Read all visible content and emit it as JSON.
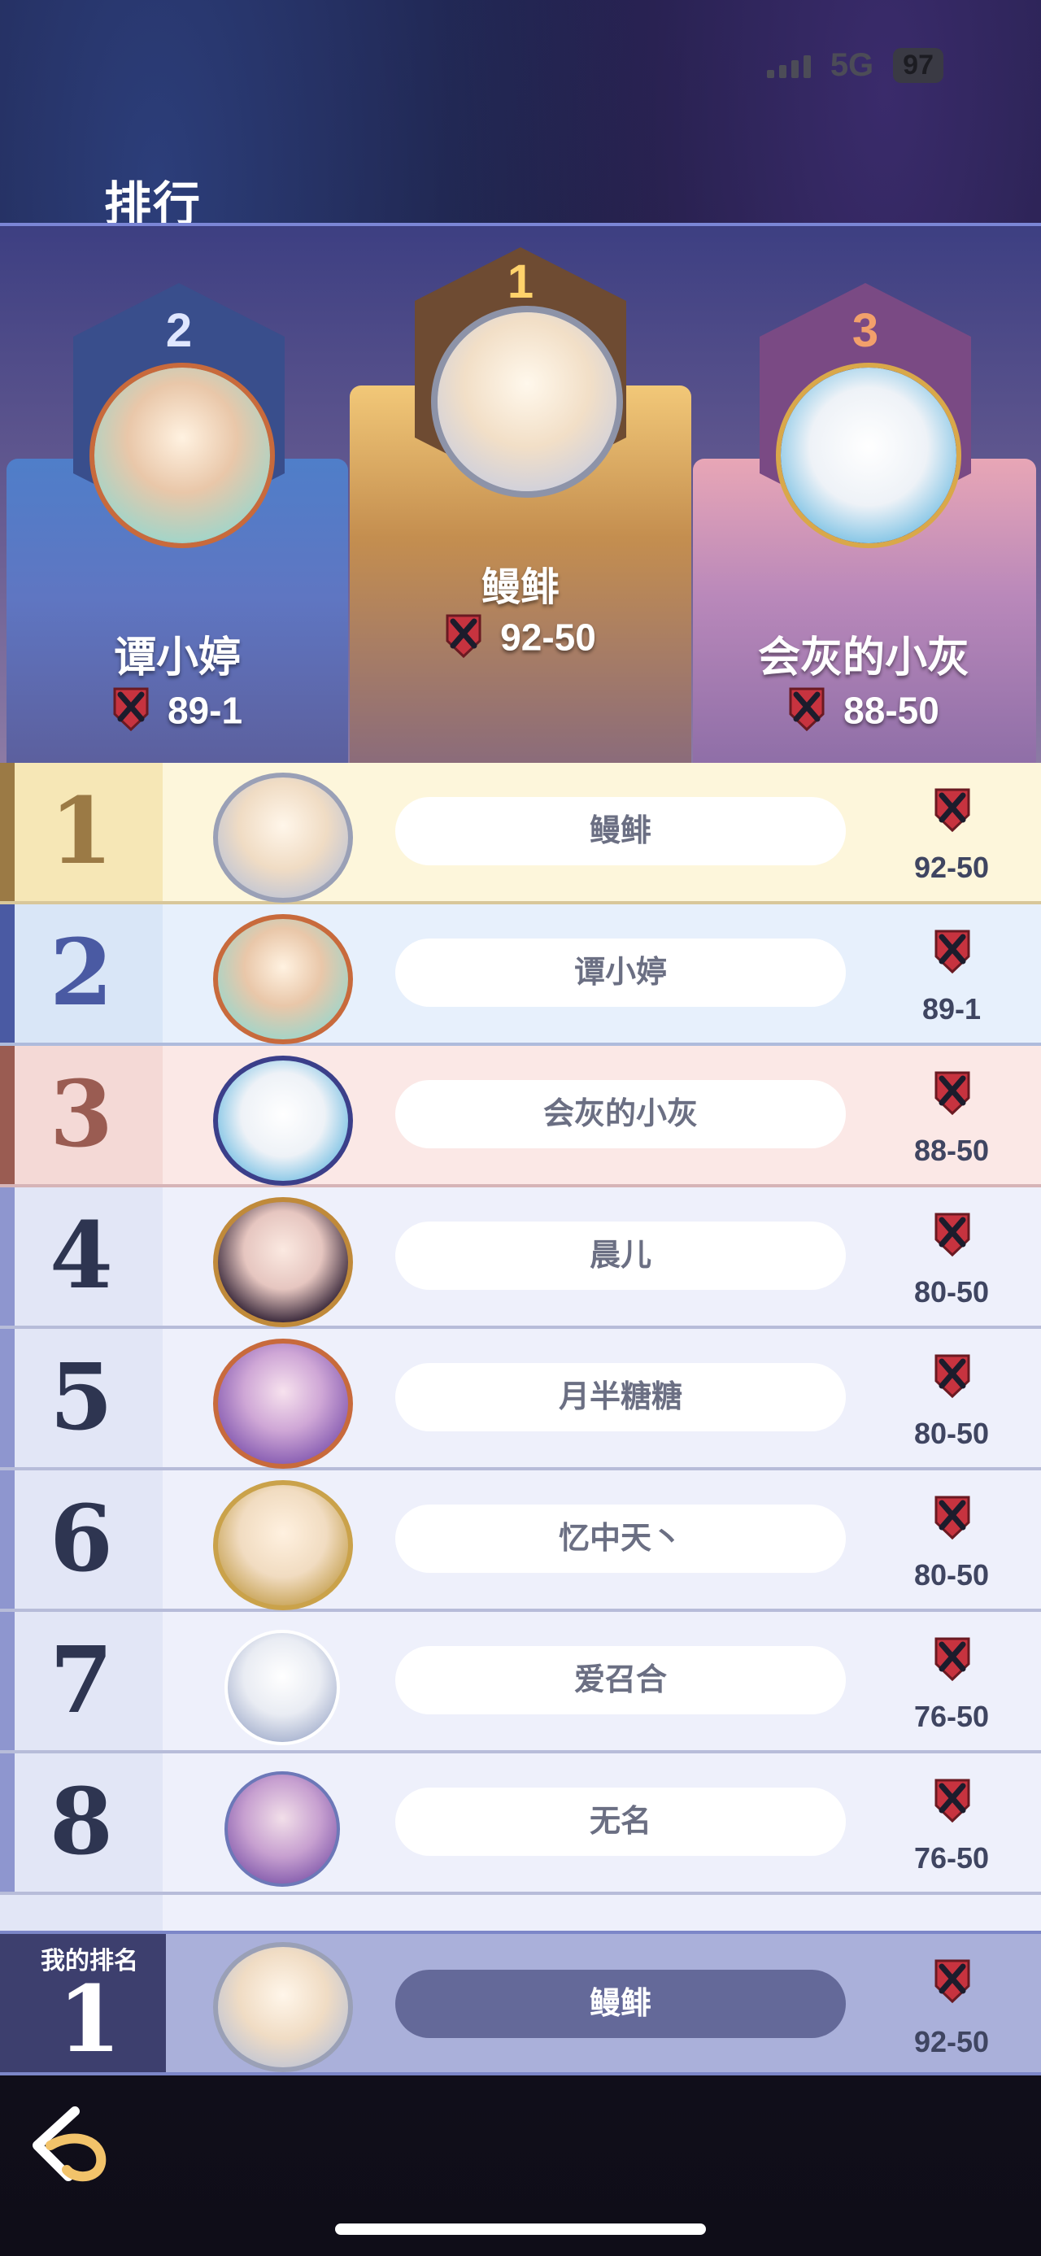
{
  "status_bar": {
    "network": "5G",
    "battery": "97"
  },
  "page_title": "排行",
  "podium": [
    {
      "rank": "2",
      "name": "谭小婷",
      "score": "89-1",
      "accent": "#8e9ce0"
    },
    {
      "rank": "1",
      "name": "鳗鲱",
      "score": "92-50",
      "accent": "#f0b24a"
    },
    {
      "rank": "3",
      "name": "会灰的小灰",
      "score": "88-50",
      "accent": "#e59a6f"
    }
  ],
  "ranking": [
    {
      "rank": "1",
      "name": "鳗鲱",
      "score": "92-50"
    },
    {
      "rank": "2",
      "name": "谭小婷",
      "score": "89-1"
    },
    {
      "rank": "3",
      "name": "会灰的小灰",
      "score": "88-50"
    },
    {
      "rank": "4",
      "name": "晨儿",
      "score": "80-50"
    },
    {
      "rank": "5",
      "name": "月半糖糖",
      "score": "80-50"
    },
    {
      "rank": "6",
      "name": "忆中天丶",
      "score": "80-50"
    },
    {
      "rank": "7",
      "name": "爱召合",
      "score": "76-50"
    },
    {
      "rank": "8",
      "name": "无名",
      "score": "76-50"
    }
  ],
  "my_rank": {
    "label": "我的排名",
    "rank": "1",
    "name": "鳗鲱",
    "score": "92-50"
  },
  "icons": {
    "score_icon": "crossed-swords-shield-icon",
    "back": "back-arrow-icon"
  }
}
